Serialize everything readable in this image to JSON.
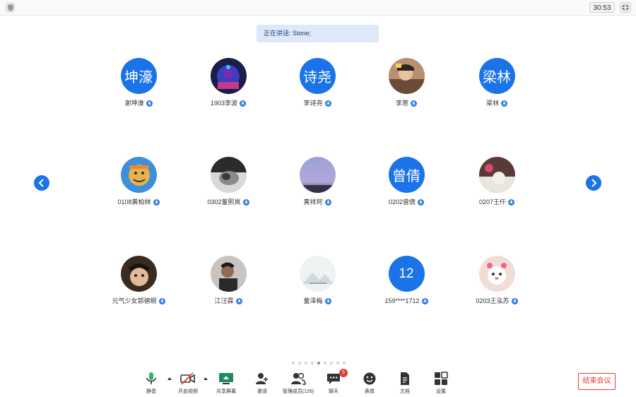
{
  "topbar": {
    "timer": "30:53",
    "security_icon": "shield-icon",
    "exit_fullscreen_icon": "exit-fullscreen-icon"
  },
  "speaking": "正在讲话: Stone;",
  "participants": [
    {
      "name": "谢坤濠",
      "avatar_text": "坤濠",
      "avatar_type": "text"
    },
    {
      "name": "1903李波",
      "avatar_text": "",
      "avatar_type": "photo"
    },
    {
      "name": "李诗尧",
      "avatar_text": "诗尧",
      "avatar_type": "text"
    },
    {
      "name": "李葱",
      "avatar_text": "",
      "avatar_type": "photo"
    },
    {
      "name": "梁林",
      "avatar_text": "梁林",
      "avatar_type": "text"
    },
    {
      "name": "0108黄柏林",
      "avatar_text": "",
      "avatar_type": "photo"
    },
    {
      "name": "0302董熙岚",
      "avatar_text": "",
      "avatar_type": "photo"
    },
    {
      "name": "黄祥珂",
      "avatar_text": "",
      "avatar_type": "photo"
    },
    {
      "name": "0202曾倩",
      "avatar_text": "曾倩",
      "avatar_type": "text"
    },
    {
      "name": "0207王仟",
      "avatar_text": "",
      "avatar_type": "photo"
    },
    {
      "name": "元气少女郭德纲",
      "avatar_text": "",
      "avatar_type": "photo"
    },
    {
      "name": "江汪霖",
      "avatar_text": "",
      "avatar_type": "photo"
    },
    {
      "name": "董泽梅",
      "avatar_text": "",
      "avatar_type": "photo"
    },
    {
      "name": "159****1712",
      "avatar_text": "12",
      "avatar_type": "text"
    },
    {
      "name": "0203王泓苏",
      "avatar_text": "",
      "avatar_type": "photo"
    }
  ],
  "pagination": {
    "total": 9,
    "active_index": 4
  },
  "toolbar": {
    "mute": "静音",
    "video": "开启视频",
    "share": "共享屏幕",
    "invite": "邀请",
    "members": "管理成员(126)",
    "chat": "聊天",
    "chat_badge": "5",
    "reactions": "表情",
    "docs": "文档",
    "settings": "设置"
  },
  "end_meeting": "结束会议",
  "colors": {
    "accent": "#1a73e8",
    "danger": "#e53935",
    "banner_bg": "#dde9fb"
  }
}
